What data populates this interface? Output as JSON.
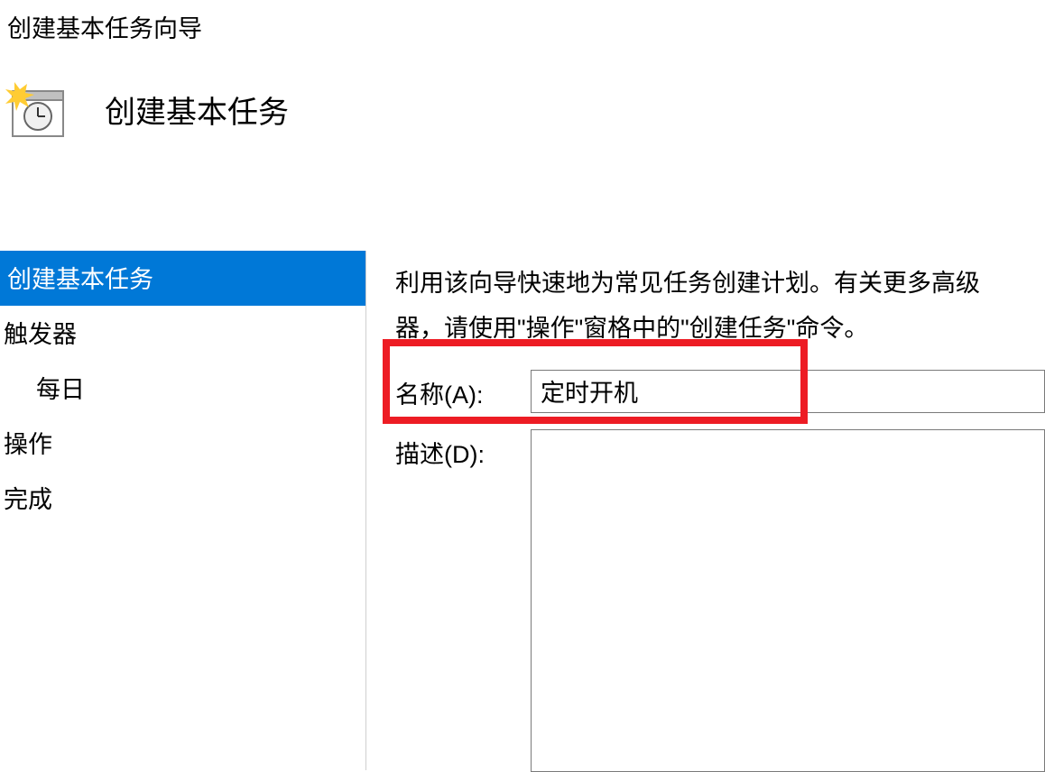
{
  "window_title": "创建基本任务向导",
  "header": {
    "title": "创建基本任务"
  },
  "sidebar": {
    "items": [
      {
        "label": "创建基本任务",
        "selected": true,
        "indented": false
      },
      {
        "label": "触发器",
        "selected": false,
        "indented": false
      },
      {
        "label": "每日",
        "selected": false,
        "indented": true
      },
      {
        "label": "操作",
        "selected": false,
        "indented": false
      },
      {
        "label": "完成",
        "selected": false,
        "indented": false
      }
    ]
  },
  "main": {
    "intro_line1": "利用该向导快速地为常见任务创建计划。有关更多高级",
    "intro_line2": "器，请使用\"操作\"窗格中的\"创建任务\"命令。",
    "name_label": "名称(A):",
    "name_value": "定时开机",
    "description_label": "描述(D):",
    "description_value": ""
  }
}
